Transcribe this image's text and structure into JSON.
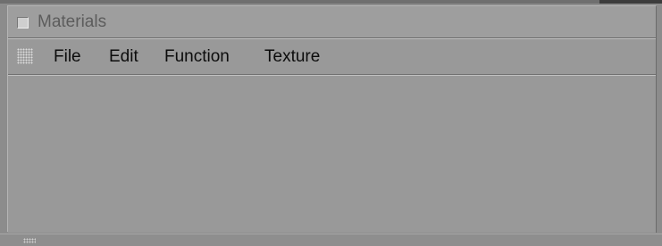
{
  "window": {
    "title": "Materials"
  },
  "menubar": {
    "items": [
      {
        "label": "File"
      },
      {
        "label": "Edit"
      },
      {
        "label": "Function"
      },
      {
        "label": "Texture"
      }
    ]
  },
  "icons": {
    "title_checkbox": "checkbox-icon",
    "menu_grip": "grip-dots-icon",
    "resize_grip": "resize-grip-icon"
  },
  "colors": {
    "panel_background": "#999999",
    "title_text": "#5c5c5c",
    "menu_text": "#0c0c0c"
  }
}
